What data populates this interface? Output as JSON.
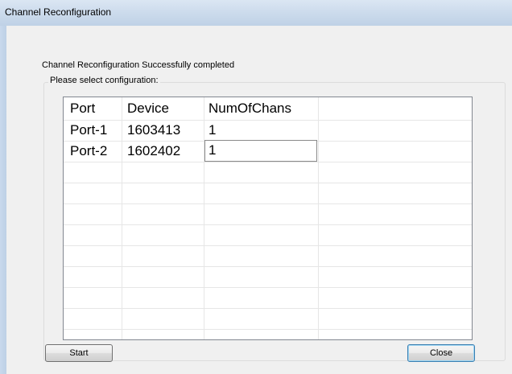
{
  "window": {
    "title": "Channel Reconfiguration"
  },
  "status": {
    "message": "Channel Reconfiguration Successfully completed"
  },
  "config_group": {
    "label": "Please select configuration:"
  },
  "grid": {
    "headers": [
      "Port",
      "Device",
      "NumOfChans"
    ],
    "rows": [
      {
        "port": "Port-1",
        "device": "1603413",
        "numofchans": "1"
      },
      {
        "port": "Port-2",
        "device": "1602402",
        "numofchans": "1"
      }
    ]
  },
  "buttons": {
    "start_label": "Start",
    "close_label": "Close"
  }
}
